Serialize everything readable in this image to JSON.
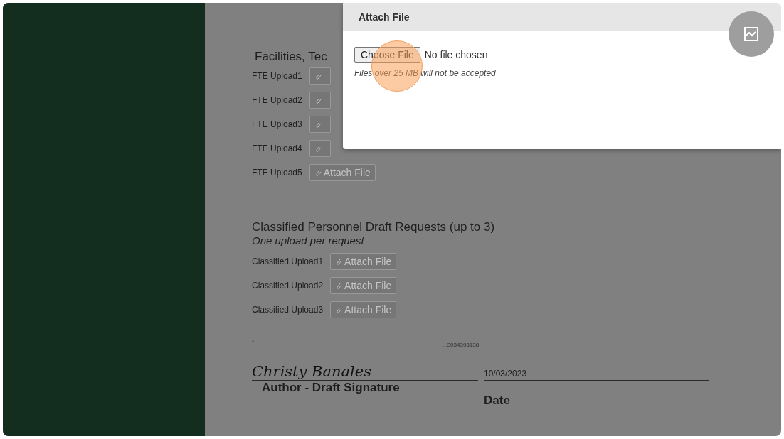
{
  "page": {
    "section_title": "Facilities, Tec",
    "fte_uploads": [
      {
        "label": "FTE Upload1"
      },
      {
        "label": "FTE Upload2"
      },
      {
        "label": "FTE Upload3"
      },
      {
        "label": "FTE Upload4"
      },
      {
        "label": "FTE Upload5",
        "button": "Attach File"
      }
    ],
    "classified_title": "Classified Personnel Draft Requests (up to 3)",
    "classified_note": "One upload per request",
    "classified_uploads": [
      {
        "label": "Classified Upload1",
        "button": "Attach File"
      },
      {
        "label": "Classified Upload2",
        "button": "Attach File"
      },
      {
        "label": "Classified Upload3",
        "button": "Attach File"
      }
    ],
    "signature": {
      "mark": "*",
      "code": "...3034393138",
      "name": "Christy Banales",
      "caption": "Author - Draft  Signature",
      "date": "10/03/2023",
      "date_caption": "Date"
    }
  },
  "dialog": {
    "title": "Attach File",
    "choose_button": "Choose File",
    "file_status": "No file chosen",
    "note": "Files over 25 MB will not be accepted"
  }
}
